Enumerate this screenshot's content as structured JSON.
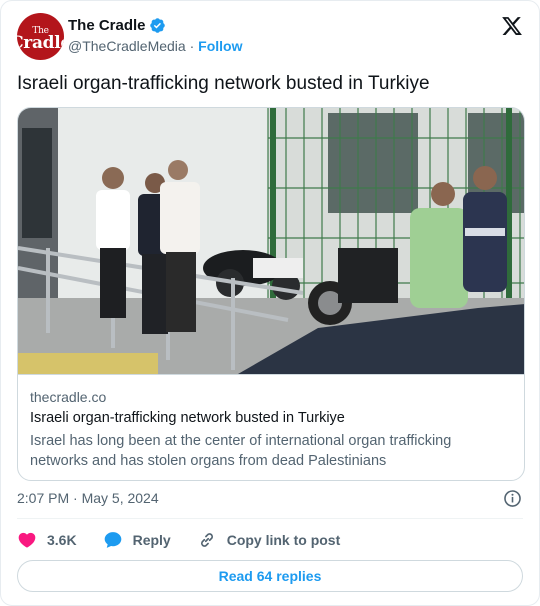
{
  "author": {
    "display_name": "The Cradle",
    "handle": "@TheCradleMedia",
    "separator": "·",
    "follow_label": "Follow",
    "avatar": {
      "logo_line1": "The",
      "logo_line2": "Cradle",
      "bg_color": "#b3151b"
    },
    "verified_badge": "verified-badge-icon"
  },
  "tweet": {
    "text": "Israeli organ-trafficking network busted in Turkiye"
  },
  "link_card": {
    "image_icon": "photo-police-escort",
    "domain": "thecradle.co",
    "title": "Israeli organ-trafficking network busted in Turkiye",
    "description": "Israel has long been at the center of international organ trafficking networks and has stolen organs from dead Palestinians"
  },
  "timestamp": "2:07 PM · May 5, 2024",
  "actions": {
    "likes_count": "3.6K",
    "reply_label": "Reply",
    "copy_label": "Copy link to post"
  },
  "read_replies_label": "Read 64 replies",
  "colors": {
    "accent": "#1d9bf0",
    "like": "#f91880",
    "text_secondary": "#536471"
  }
}
